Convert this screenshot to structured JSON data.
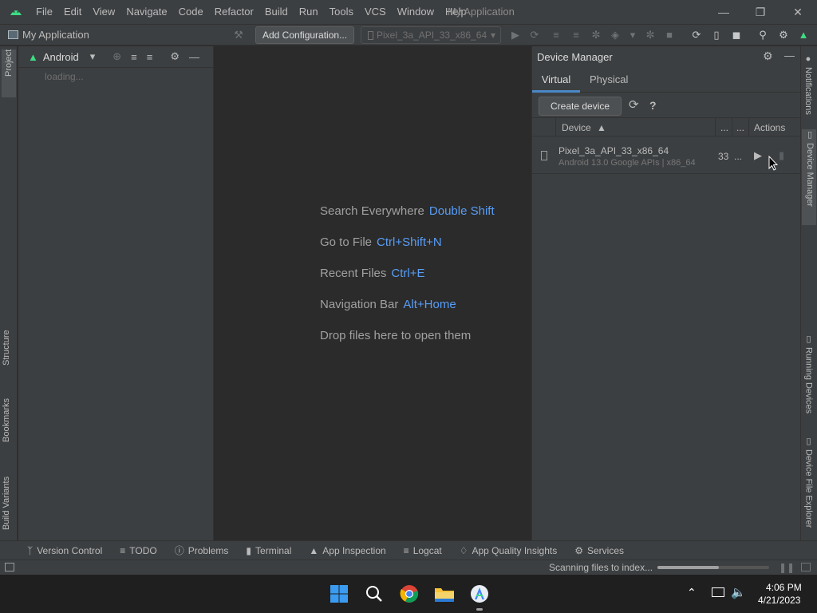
{
  "titlebar": {
    "app_title": "My Application",
    "menus": [
      "File",
      "Edit",
      "View",
      "Navigate",
      "Code",
      "Refactor",
      "Build",
      "Run",
      "Tools",
      "VCS",
      "Window",
      "Help"
    ]
  },
  "toolbar": {
    "project_name": "My Application",
    "add_config_label": "Add Configuration...",
    "device_select": "Pixel_3a_API_33_x86_64"
  },
  "left_strip": {
    "project_tab": "Project",
    "structure_tab": "Structure",
    "bookmarks_tab": "Bookmarks",
    "build_variants_tab": "Build Variants"
  },
  "project_pane": {
    "view_mode": "Android",
    "loading_text": "loading..."
  },
  "editor_hints": [
    {
      "label": "Search Everywhere",
      "shortcut": "Double Shift"
    },
    {
      "label": "Go to File",
      "shortcut": "Ctrl+Shift+N"
    },
    {
      "label": "Recent Files",
      "shortcut": "Ctrl+E"
    },
    {
      "label": "Navigation Bar",
      "shortcut": "Alt+Home"
    },
    {
      "label": "Drop files here to open them",
      "shortcut": ""
    }
  ],
  "device_manager": {
    "title": "Device Manager",
    "tabs": [
      "Virtual",
      "Physical"
    ],
    "create_device_label": "Create device",
    "help_label": "?",
    "columns": {
      "device": "Device",
      "col2": "...",
      "col3": "...",
      "actions": "Actions"
    },
    "devices": [
      {
        "name": "Pixel_3a_API_33_x86_64",
        "details": "Android 13.0 Google APIs | x86_64",
        "api": "33",
        "more": "..."
      }
    ]
  },
  "right_strip": {
    "notifications_tab": "Notifications",
    "device_manager_tab": "Device Manager",
    "running_devices_tab": "Running Devices",
    "device_file_explorer_tab": "Device File Explorer"
  },
  "bottom_tabs": [
    "Version Control",
    "TODO",
    "Problems",
    "Terminal",
    "App Inspection",
    "Logcat",
    "App Quality Insights",
    "Services"
  ],
  "status": {
    "indexing_text": "Scanning files to index...",
    "indexing_progress": 0.55
  },
  "taskbar": {
    "time": "4:06 PM",
    "date": "4/21/2023"
  },
  "colors": {
    "accent": "#589df6",
    "panel": "#3c3f41",
    "editor": "#2b2b2b",
    "android_green": "#3ddc84"
  }
}
